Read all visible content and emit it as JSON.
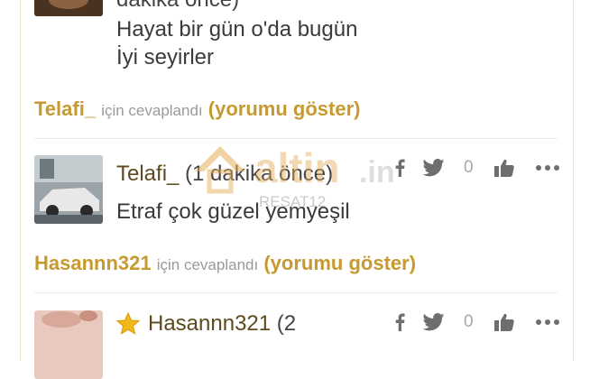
{
  "comment_top": {
    "time": "dakika önce)",
    "lines": [
      "Hayat bir gün o'da bugün",
      "İyi seyirler"
    ]
  },
  "reply_1": {
    "name": "Telafi_",
    "middle": "için cevaplandı",
    "show": "(yorumu göster)"
  },
  "comment_2": {
    "author": "Telafi_",
    "time": "(1 dakika önce)",
    "text": "Etraf çok güzel yemyeşil",
    "like_count": "0"
  },
  "reply_2": {
    "name": "Hasannn321",
    "middle": "için cevaplandı",
    "show": "(yorumu göster)"
  },
  "comment_3": {
    "author": "Hasannn321",
    "time": "(2",
    "like_count": "0"
  },
  "watermark": {
    "brand": "altin",
    "tld": ".in",
    "code": "RESAT12"
  },
  "colors": {
    "accent": "#c79a2f",
    "author": "#5d4a1e",
    "icon": "#6e6e6e"
  }
}
